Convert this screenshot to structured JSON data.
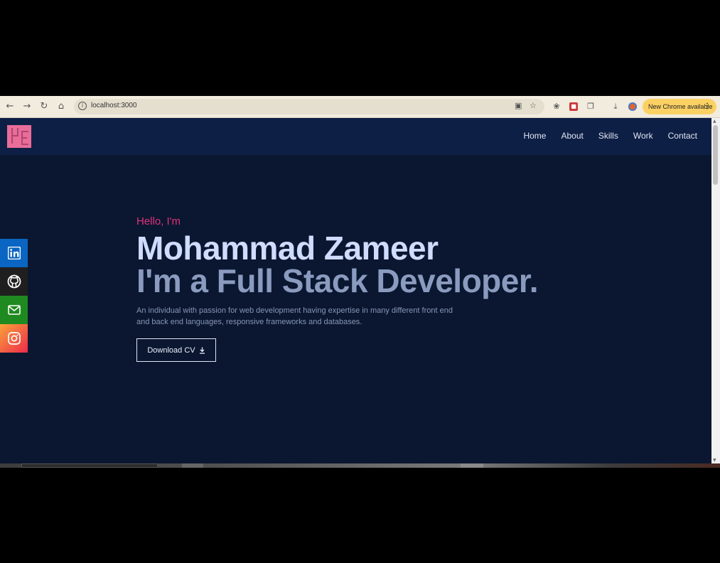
{
  "browser": {
    "url": "localhost:3000",
    "update_banner": "New Chrome available",
    "icons": [
      "back-arrow-icon",
      "forward-arrow-icon",
      "reload-icon",
      "home-icon",
      "site-info-icon",
      "install-app-icon",
      "bookmark-star-icon",
      "extension-bug-icon",
      "extension-red-icon",
      "puzzle-extensions-icon",
      "download-icon",
      "profile-avatar-icon",
      "more-dots-icon"
    ],
    "update_banner_color": "#fbd163"
  },
  "site": {
    "nav": [
      "Home",
      "About",
      "Skills",
      "Work",
      "Contact"
    ],
    "hero": {
      "greeting": "Hello, I'm",
      "name": "Mohammad Zameer",
      "role": "I'm a Full Stack Developer.",
      "description": "An individual with passion for web development having expertise in many different front end and back end languages, responsive frameworks and databases.",
      "cta_label": "Download CV"
    },
    "social": [
      {
        "icon": "linkedin-icon",
        "color": "#0a66c2"
      },
      {
        "icon": "github-icon",
        "color": "#1f1f1f"
      },
      {
        "icon": "mail-icon",
        "color": "#1f8a1f"
      },
      {
        "icon": "instagram-icon",
        "color": "#ee2a4a"
      }
    ],
    "colors": {
      "background": "#0b1730",
      "navbar": "#0e1f45",
      "accent": "#e0317a",
      "heading": "#cfdcff",
      "subheading": "#8a9bbf"
    }
  }
}
